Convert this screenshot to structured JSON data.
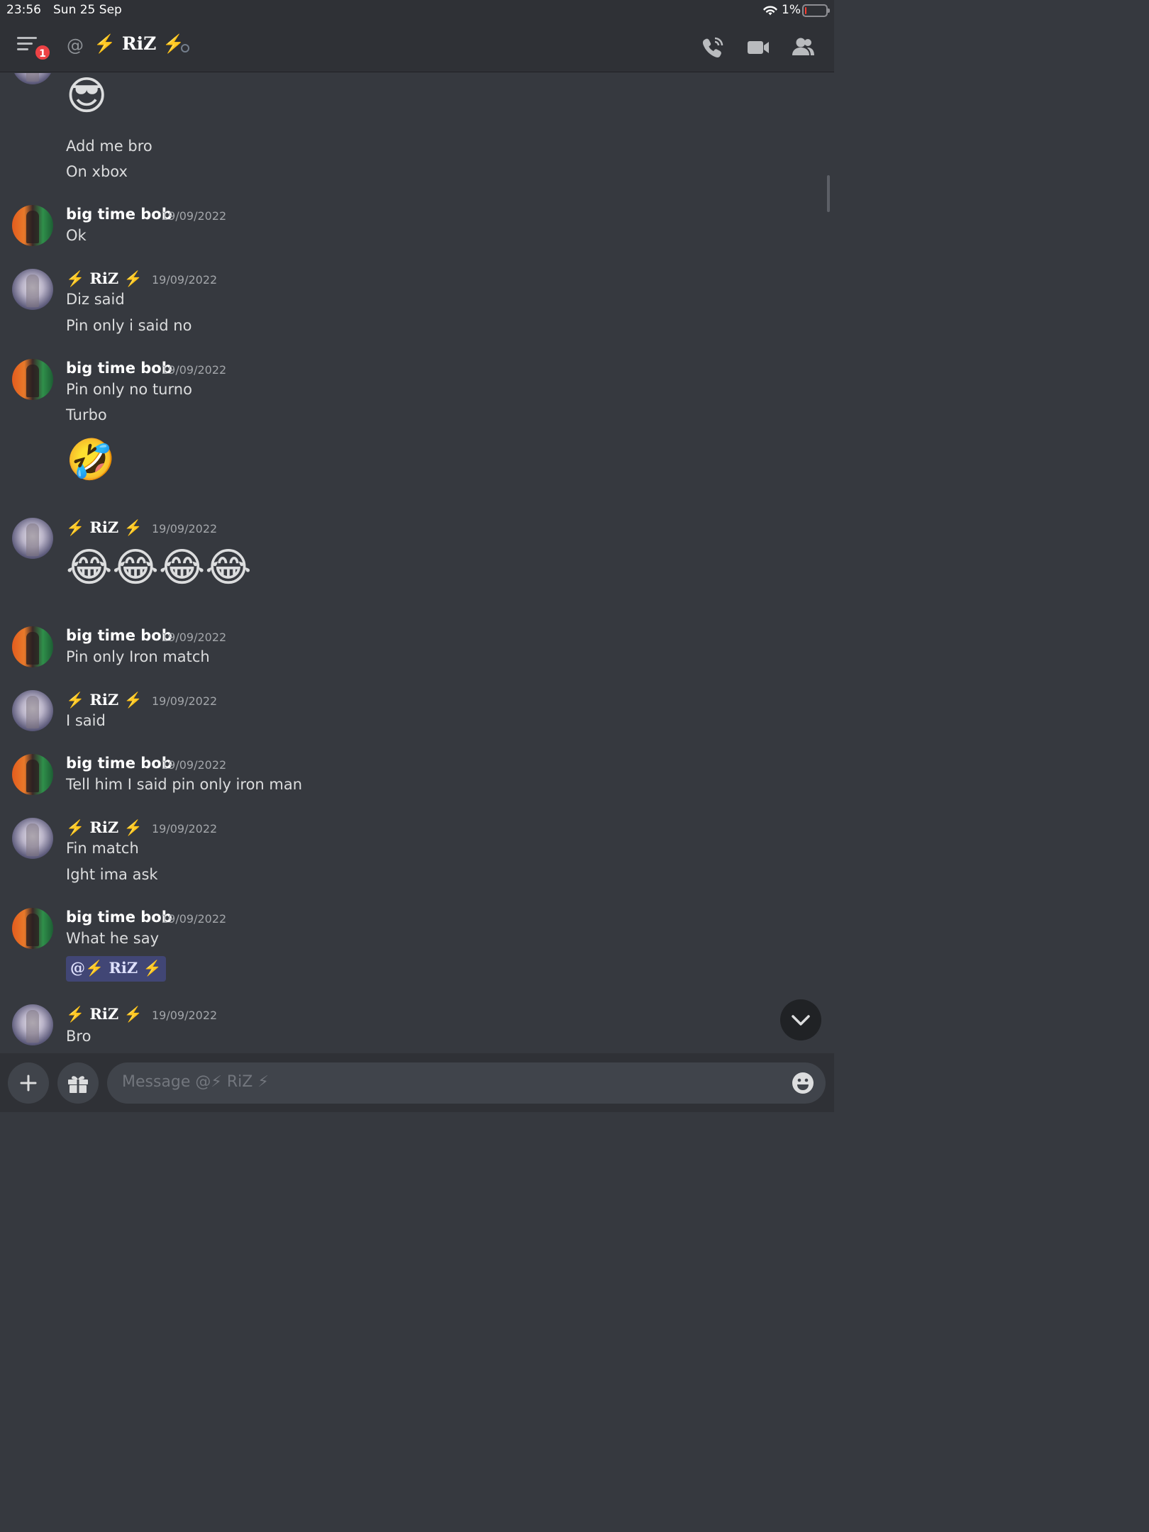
{
  "status_bar": {
    "time": "23:56",
    "date": "Sun 25 Sep",
    "battery_percent": "1%"
  },
  "header": {
    "notification_count": "1",
    "at_symbol": "@",
    "channel_name": "⚡ RiZ ⚡"
  },
  "messages": [
    {
      "lines": [
        "😎",
        "Add me bro",
        "On xbox"
      ]
    },
    {
      "author": "big time bob",
      "timestamp": "19/09/2022",
      "lines": [
        "Ok"
      ]
    },
    {
      "author": "⚡ RiZ ⚡",
      "timestamp": "19/09/2022",
      "lines": [
        "Diz said",
        "Pin only i said no"
      ]
    },
    {
      "author": "big time bob",
      "timestamp": "19/09/2022",
      "lines": [
        "Pin only no turno",
        "Turbo",
        "🤣"
      ]
    },
    {
      "author": "⚡ RiZ ⚡",
      "timestamp": "19/09/2022",
      "lines": [
        "😂😂😂😂"
      ]
    },
    {
      "author": "big time bob",
      "timestamp": "19/09/2022",
      "lines": [
        "Pin only Iron match"
      ]
    },
    {
      "author": "⚡ RiZ ⚡",
      "timestamp": "19/09/2022",
      "lines": [
        "I said"
      ]
    },
    {
      "author": "big time bob",
      "timestamp": "19/09/2022",
      "lines": [
        "Tell him I said pin only iron man"
      ]
    },
    {
      "author": "⚡ RiZ ⚡",
      "timestamp": "19/09/2022",
      "lines": [
        "Fin match",
        "Ight ima ask"
      ]
    },
    {
      "author": "big time bob",
      "timestamp": "19/09/2022",
      "lines": [
        "What he say"
      ],
      "mention": "@⚡ RiZ ⚡"
    },
    {
      "author": "⚡ RiZ ⚡",
      "timestamp": "19/09/2022",
      "lines": [
        "Bro"
      ]
    }
  ],
  "composer": {
    "placeholder": "Message @⚡ RiZ ⚡"
  },
  "icons": {
    "menu": "hamburger-menu-icon",
    "call": "phone-call-icon",
    "video": "video-camera-icon",
    "members": "members-icon",
    "plus": "plus-icon",
    "gift": "gift-icon",
    "emoji": "emoji-icon",
    "jump": "chevron-down-icon"
  },
  "colors": {
    "background": "#36393f",
    "header_bg": "#2f3136",
    "badge": "#ed4245",
    "mention_bg": "#414675",
    "timestamp": "#a3a6aa"
  }
}
